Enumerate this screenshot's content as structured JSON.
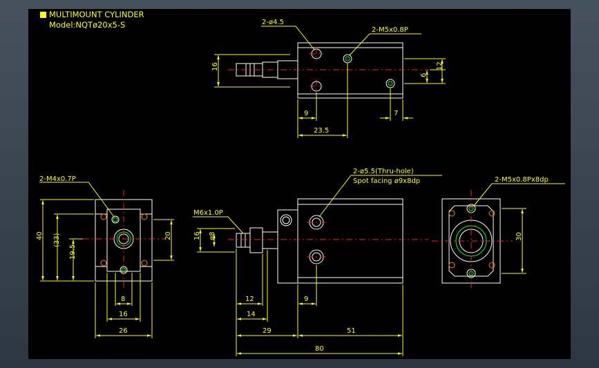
{
  "title": {
    "line1": "MULTIMOUNT CYLINDER",
    "line2": "Model:NQTø20x5-S"
  },
  "colors": {
    "background": "#000000",
    "outline": "#ffffff",
    "dimension": "#ffff00",
    "centerline": "#ff2020",
    "thread": "#00ff00",
    "hidden": "#ff8000"
  },
  "top_view": {
    "callout_holes": "2-ø4.5",
    "callout_ports": "2-M5x0.8P",
    "dim_height": "16",
    "dim_12": "12",
    "dim_6": "6",
    "dim_9": "9",
    "dim_7": "7",
    "dim_23_5": "23.5"
  },
  "front_view": {
    "callout_thread": "M6x1.0P",
    "callout_thru_hole": "2-ø5.5(Thru-hole)",
    "callout_spot_facing": "Spot facing ø9x8dp",
    "dim_16": "16",
    "dim_rod": "ø8",
    "dim_12": "12",
    "dim_14": "14",
    "dim_9": "9",
    "dim_29": "29",
    "dim_51": "51",
    "dim_80": "80"
  },
  "left_view": {
    "callout_tap": "2-M4x0.7P",
    "dim_40": "40",
    "dim_33": "(33)",
    "dim_19_5": "19.5",
    "dim_20": "20",
    "dim_8": "8",
    "dim_16": "16",
    "dim_26": "26"
  },
  "right_view": {
    "callout_tap": "2-M5x0.8Px8dp",
    "dim_30": "30"
  }
}
